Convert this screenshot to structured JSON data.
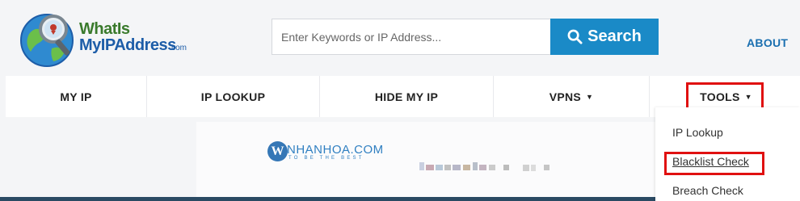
{
  "header": {
    "logo": {
      "line1": "WhatIs",
      "line2": "MyIPAddress",
      "line3": ".com"
    },
    "search": {
      "placeholder": "Enter Keywords or IP Address...",
      "button_label": "Search"
    },
    "about_label": "ABOUT"
  },
  "nav": {
    "items": [
      {
        "label": "MY IP",
        "has_caret": false
      },
      {
        "label": "IP LOOKUP",
        "has_caret": false
      },
      {
        "label": "HIDE MY IP",
        "has_caret": false
      },
      {
        "label": "VPNS",
        "has_caret": true
      },
      {
        "label": "TOOLS",
        "has_caret": true
      }
    ],
    "caret": "▼"
  },
  "ad": {
    "brand": "NHANHOA.COM",
    "tagline": "TO BE THE BEST",
    "logo_letter": "W"
  },
  "dropdown": {
    "items": [
      {
        "label": "IP Lookup"
      },
      {
        "label": "Blacklist Check"
      },
      {
        "label": "Breach Check"
      }
    ]
  },
  "colors": {
    "accent": "#1a8ac7",
    "highlight": "#e01010",
    "link": "#1a6fb0",
    "logo_green": "#3a7a2c",
    "logo_blue": "#1d5da8"
  },
  "icons": [
    "globe-magnifier-logo-icon",
    "search-icon",
    "caret-down-icon"
  ]
}
